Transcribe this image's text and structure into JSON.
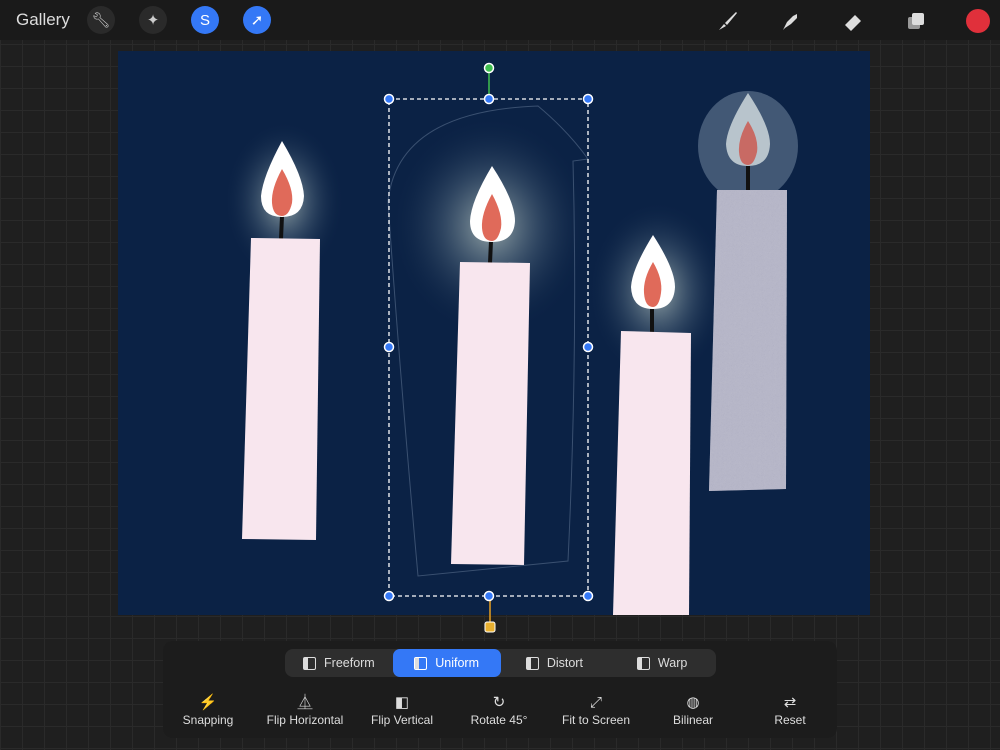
{
  "topbar": {
    "gallery": "Gallery",
    "tools_left": [
      "wrench-icon",
      "magic-wand-icon",
      "selection-icon",
      "transform-arrow-icon"
    ],
    "tools_right": [
      "brush-icon",
      "smudge-icon",
      "eraser-icon",
      "layers-icon"
    ],
    "current_color": "#e0303b"
  },
  "transform": {
    "modes": [
      {
        "label": "Freeform",
        "active": false
      },
      {
        "label": "Uniform",
        "active": true
      },
      {
        "label": "Distort",
        "active": false
      },
      {
        "label": "Warp",
        "active": false
      }
    ],
    "actions": [
      {
        "label": "Snapping",
        "icon": "⚡"
      },
      {
        "label": "Flip Horizontal",
        "icon": "⏅"
      },
      {
        "label": "Flip Vertical",
        "icon": "◧"
      },
      {
        "label": "Rotate 45°",
        "icon": "↻"
      },
      {
        "label": "Fit to Screen",
        "icon": "⤢"
      },
      {
        "label": "Bilinear",
        "icon": "◍"
      },
      {
        "label": "Reset",
        "icon": "⇄"
      }
    ]
  },
  "colors": {
    "canvas_bg": "#0b2245",
    "accent": "#3478f6",
    "candle": "#f8e6ee",
    "flame": "#e06a5a"
  }
}
